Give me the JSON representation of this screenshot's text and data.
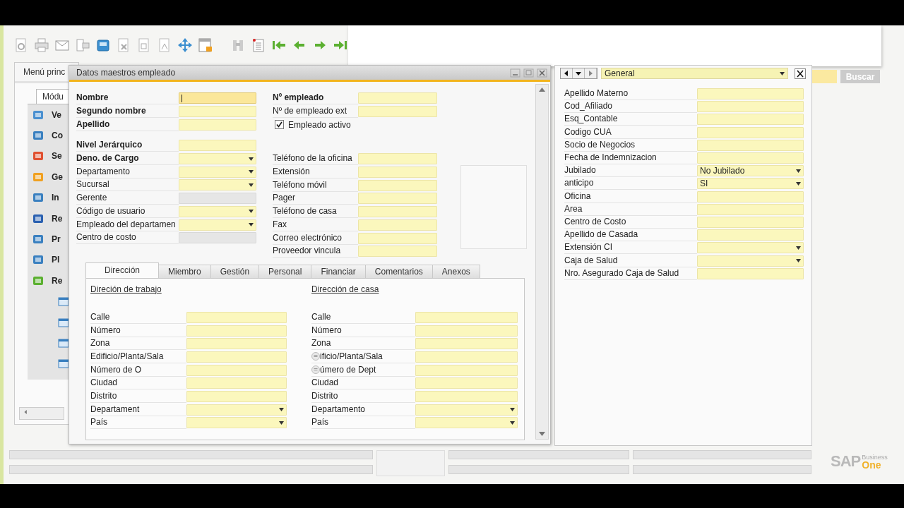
{
  "main_menu": {
    "title": "Menú princ",
    "tab": "Módu",
    "items": [
      {
        "label": "Ve"
      },
      {
        "label": "Co"
      },
      {
        "label": "Se"
      },
      {
        "label": "Ge"
      },
      {
        "label": "In"
      },
      {
        "label": "Re"
      },
      {
        "label": "Pr"
      },
      {
        "label": "Pl"
      },
      {
        "label": "Re"
      }
    ]
  },
  "employee_window": {
    "title": "Datos maestros empleado",
    "header_columns": [
      {
        "groups": [
          [
            {
              "label": "Nombre",
              "bold": true,
              "kind": "text",
              "focused": true
            },
            {
              "label": "Segundo nombre",
              "bold": true,
              "kind": "text",
              "focused": false
            },
            {
              "label": "Apellido",
              "bold": true,
              "kind": "text",
              "focused": false
            }
          ],
          [
            {
              "label": "Nivel Jerárquico",
              "bold": true,
              "kind": "text",
              "focused": false
            },
            {
              "label": "Deno. de Cargo",
              "bold": true,
              "kind": "dropdown",
              "focused": false
            },
            {
              "label": "Departamento",
              "bold": false,
              "kind": "dropdown",
              "focused": false
            },
            {
              "label": "Sucursal",
              "bold": false,
              "kind": "dropdown",
              "focused": false
            },
            {
              "label": "Gerente",
              "bold": false,
              "kind": "readonly",
              "focused": false
            },
            {
              "label": "Código de usuario",
              "bold": false,
              "kind": "dropdown",
              "focused": false
            },
            {
              "label": "Empleado del departamen",
              "bold": false,
              "kind": "dropdown",
              "focused": false
            },
            {
              "label": "Centro de costo",
              "bold": false,
              "kind": "readonly",
              "focused": false
            }
          ]
        ]
      },
      {
        "groups": [
          [
            {
              "label": "Nº empleado",
              "bold": true,
              "kind": "text",
              "focused": false
            },
            {
              "label": "Nº de empleado ext",
              "bold": false,
              "kind": "text",
              "focused": false
            },
            {
              "label": "Empleado activo",
              "bold": false,
              "kind": "checkbox",
              "checked": true
            }
          ],
          [
            {
              "label": "Teléfono de la oficina",
              "bold": false,
              "kind": "text",
              "focused": false
            },
            {
              "label": "Extensión",
              "bold": false,
              "kind": "text",
              "focused": false
            },
            {
              "label": "Teléfono móvil",
              "bold": false,
              "kind": "text",
              "focused": false
            },
            {
              "label": "Pager",
              "bold": false,
              "kind": "text",
              "focused": false
            },
            {
              "label": "Teléfono de casa",
              "bold": false,
              "kind": "text",
              "focused": false
            },
            {
              "label": "Fax",
              "bold": false,
              "kind": "text",
              "focused": false
            },
            {
              "label": "Correo electrónico",
              "bold": false,
              "kind": "text",
              "focused": false
            },
            {
              "label": "Proveedor vincula",
              "bold": false,
              "kind": "text",
              "focused": false
            }
          ]
        ]
      }
    ],
    "tabs": [
      {
        "label": "Dirección",
        "selected": true
      },
      {
        "label": "Miembro",
        "selected": false
      },
      {
        "label": "Gestión",
        "selected": false
      },
      {
        "label": "Personal",
        "selected": false
      },
      {
        "label": "Financiar",
        "selected": false
      },
      {
        "label": "Comentarios",
        "selected": false
      },
      {
        "label": "Anexos",
        "selected": false
      }
    ],
    "address_sections": [
      {
        "heading": "Direción de trabajo",
        "fields": [
          {
            "label": "Calle",
            "kind": "text",
            "note_marker": false
          },
          {
            "label": "Número",
            "kind": "text",
            "note_marker": false
          },
          {
            "label": "Zona",
            "kind": "text",
            "note_marker": false
          },
          {
            "label": "Edificio/Planta/Sala",
            "kind": "text",
            "note_marker": false
          },
          {
            "label": "Número de O",
            "kind": "text",
            "note_marker": false
          },
          {
            "label": "Ciudad",
            "kind": "text",
            "note_marker": false
          },
          {
            "label": "Distrito",
            "kind": "text",
            "note_marker": false
          },
          {
            "label": "Departament",
            "kind": "dropdown",
            "note_marker": false
          },
          {
            "label": "País",
            "kind": "dropdown",
            "note_marker": false
          }
        ]
      },
      {
        "heading": "Dirección de casa",
        "fields": [
          {
            "label": "Calle",
            "kind": "text",
            "note_marker": false
          },
          {
            "label": "Número",
            "kind": "text",
            "note_marker": false
          },
          {
            "label": "Zona",
            "kind": "text",
            "note_marker": false
          },
          {
            "label": "ificio/Planta/Sala",
            "kind": "text",
            "note_marker": true
          },
          {
            "label": "úmero de Dept",
            "kind": "text",
            "note_marker": true
          },
          {
            "label": "Ciudad",
            "kind": "text",
            "note_marker": false
          },
          {
            "label": "Distrito",
            "kind": "text",
            "note_marker": false
          },
          {
            "label": "Departamento",
            "kind": "dropdown",
            "note_marker": false
          },
          {
            "label": "País",
            "kind": "dropdown",
            "note_marker": false
          }
        ]
      }
    ]
  },
  "user_fields_panel": {
    "view": "General",
    "fields": [
      {
        "label": "Apellido Materno",
        "kind": "text"
      },
      {
        "label": "Cod_Afiliado",
        "kind": "text"
      },
      {
        "label": "Esq_Contable",
        "kind": "text"
      },
      {
        "label": "Codigo CUA",
        "kind": "text"
      },
      {
        "label": "Socio de Negocios",
        "kind": "text"
      },
      {
        "label": "Fecha de Indemnizacion",
        "kind": "text"
      },
      {
        "label": "Jubilado",
        "kind": "dropdown",
        "value": "No Jubilado"
      },
      {
        "label": "anticipo",
        "kind": "dropdown",
        "value": "SI"
      },
      {
        "label": "Oficina",
        "kind": "text"
      },
      {
        "label": "Area",
        "kind": "text"
      },
      {
        "label": "Centro de Costo",
        "kind": "text"
      },
      {
        "label": "Apellido de Casada",
        "kind": "text"
      },
      {
        "label": "Extensión CI",
        "kind": "dropdown"
      },
      {
        "label": "Caja de Salud",
        "kind": "dropdown"
      },
      {
        "label": "Nro. Asegurado Caja de Salud",
        "kind": "text"
      }
    ]
  },
  "search": {
    "button": "Buscar"
  },
  "logo": {
    "brand": "SAP",
    "line1": "Business",
    "line2": "One"
  }
}
